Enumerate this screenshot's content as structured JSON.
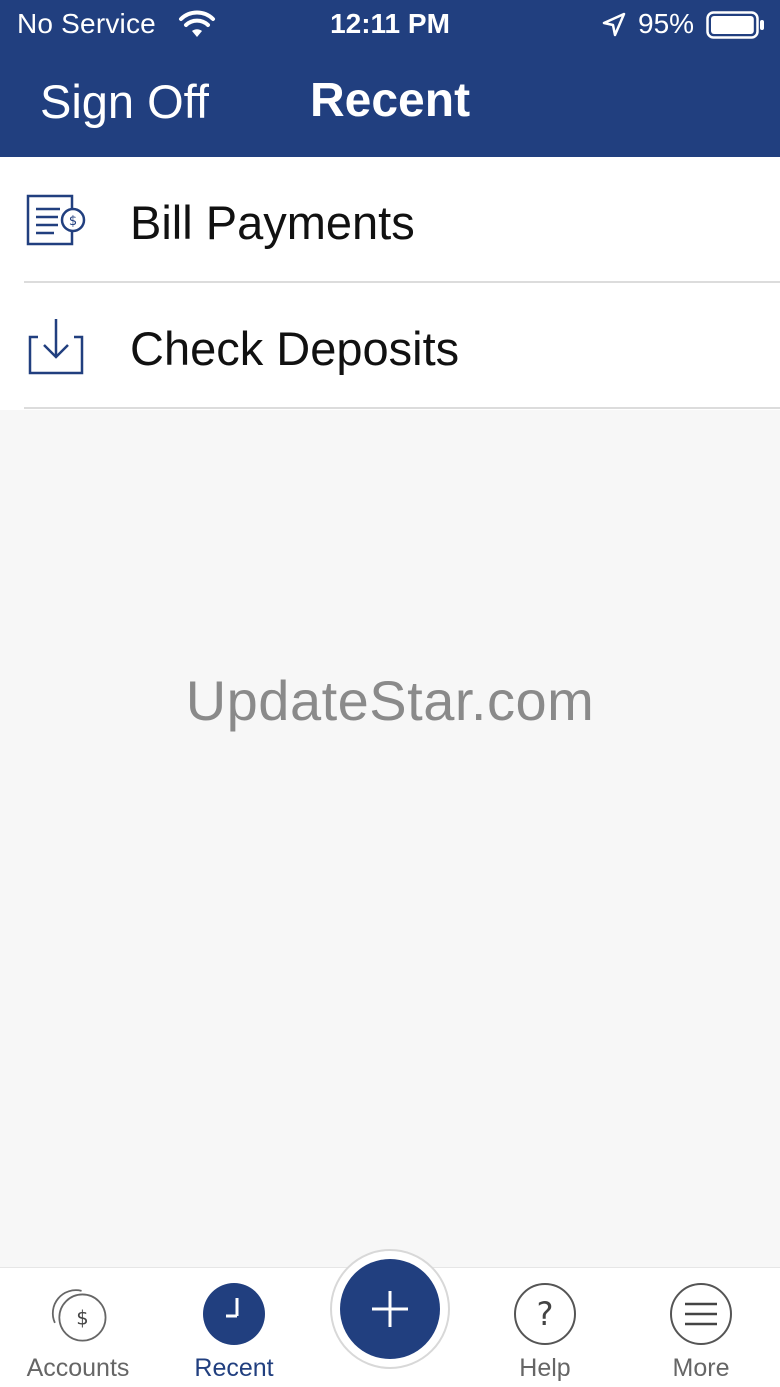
{
  "status_bar": {
    "carrier": "No Service",
    "time": "12:11 PM",
    "battery_percent": "95%",
    "battery_level": 0.95,
    "icons": [
      "wifi-icon",
      "location-arrow-icon",
      "battery-icon"
    ]
  },
  "nav": {
    "left_button": "Sign Off",
    "title": "Recent"
  },
  "list": {
    "items": [
      {
        "label": "Bill Payments",
        "icon": "bill-payment-icon"
      },
      {
        "label": "Check Deposits",
        "icon": "deposit-download-icon"
      }
    ]
  },
  "watermark": "UpdateStar.com",
  "tabbar": {
    "tabs": [
      {
        "label": "Accounts",
        "icon": "accounts-dollar-icon"
      },
      {
        "label": "Recent",
        "icon": "clock-icon",
        "selected": true
      },
      {
        "label": "Help",
        "icon": "question-icon"
      },
      {
        "label": "More",
        "icon": "menu-icon"
      }
    ],
    "fab_icon": "plus-icon"
  },
  "colors": {
    "brand": "#213f7f",
    "background": "#f7f7f7",
    "divider": "#dcdcdc",
    "inactive_tab": "#666666"
  }
}
